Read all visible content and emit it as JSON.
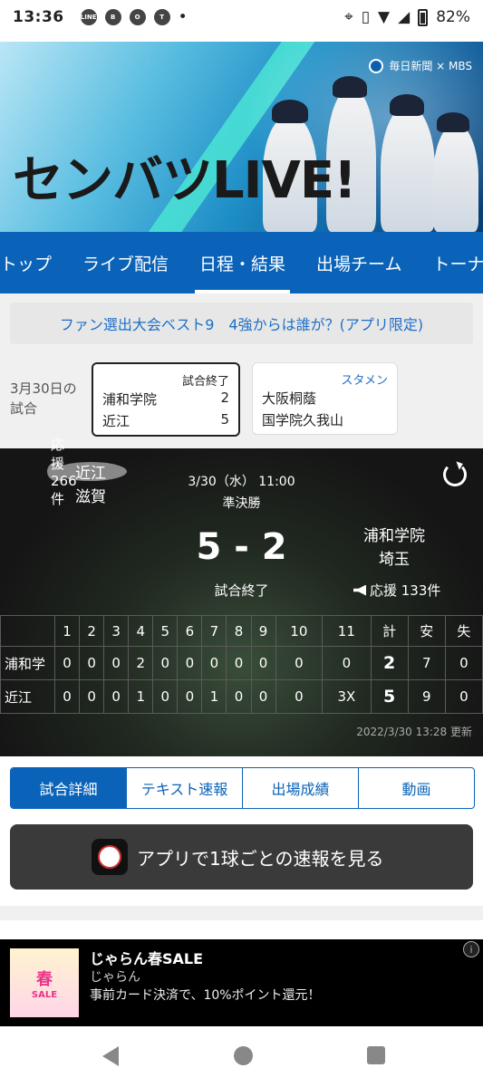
{
  "status_bar": {
    "time": "13:36",
    "app_icons": [
      "LINE",
      "B",
      "O",
      "T"
    ],
    "battery": "82%"
  },
  "banner": {
    "title": "センバツLIVE!",
    "logos": "毎日新聞 × MBS"
  },
  "nav": {
    "items": [
      "トップ",
      "ライブ配信",
      "日程・結果",
      "出場チーム",
      "トーナ"
    ],
    "active_index": 2
  },
  "promo": {
    "text": "ファン選出大会ベスト9　4強からは誰が？(アプリ限定)"
  },
  "schedule": {
    "date_label": "3月30日の試合",
    "games": [
      {
        "status": "試合終了",
        "team1": "浦和学院",
        "score1": "2",
        "team2": "近江",
        "score2": "5"
      },
      {
        "status": "スタメン",
        "team1": "大阪桐蔭",
        "team2": "国学院久我山"
      }
    ]
  },
  "game": {
    "datetime": "3/30（水） 11:00",
    "round": "準決勝",
    "home": {
      "name": "近江",
      "region": "滋賀",
      "cheer": "応援 266件"
    },
    "away": {
      "name": "浦和学院",
      "region": "埼玉",
      "cheer": "応援 133件"
    },
    "score": "5 - 2",
    "status": "試合終了",
    "updated": "2022/3/30 13:28 更新"
  },
  "scoreboard": {
    "headers": [
      "",
      "1",
      "2",
      "3",
      "4",
      "5",
      "6",
      "7",
      "8",
      "9",
      "10",
      "11",
      "計",
      "安",
      "失"
    ],
    "rows": [
      {
        "team": "浦和学",
        "innings": [
          "0",
          "0",
          "0",
          "2",
          "0",
          "0",
          "0",
          "0",
          "0",
          "0",
          "0"
        ],
        "total": "2",
        "hits": "7",
        "errors": "0"
      },
      {
        "team": "近江",
        "innings": [
          "0",
          "0",
          "0",
          "1",
          "0",
          "0",
          "1",
          "0",
          "0",
          "0",
          "3X"
        ],
        "total": "5",
        "hits": "9",
        "errors": "0"
      }
    ]
  },
  "tabs": [
    "試合詳細",
    "テキスト速報",
    "出場成績",
    "動画"
  ],
  "app_button": {
    "label": "アプリで1球ごとの速報を見る"
  },
  "ad": {
    "title": "じゃらん春SALE",
    "brand": "じゃらん",
    "text": "事前カード決済で、10%ポイント還元！",
    "thumb_main": "春",
    "thumb_sub": "SALE"
  },
  "colors": {
    "primary": "#0a63b8",
    "link": "#1e6fc6"
  }
}
